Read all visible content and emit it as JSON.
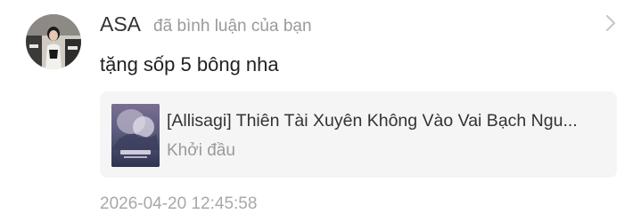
{
  "notification": {
    "user": {
      "name": "ASA",
      "avatar_icon": "user-avatar-photo"
    },
    "action": "đã bình luận của bạn",
    "comment": "tặng sốp 5 bông nha",
    "book": {
      "title": "[Allisagi] Thiên Tài Xuyên Không Vào Vai Bạch Ngu...",
      "status": "Khởi đầu",
      "cover_icon": "book-cover-image"
    },
    "timestamp": "2026-04-20 12:45:58",
    "more_icon": "chevron-right-icon"
  },
  "colors": {
    "background": "#ffffff",
    "card_background": "#f5f5f5",
    "primary_text": "#333333",
    "secondary_text": "#9a9a9a",
    "chevron": "#c8c8c8"
  }
}
